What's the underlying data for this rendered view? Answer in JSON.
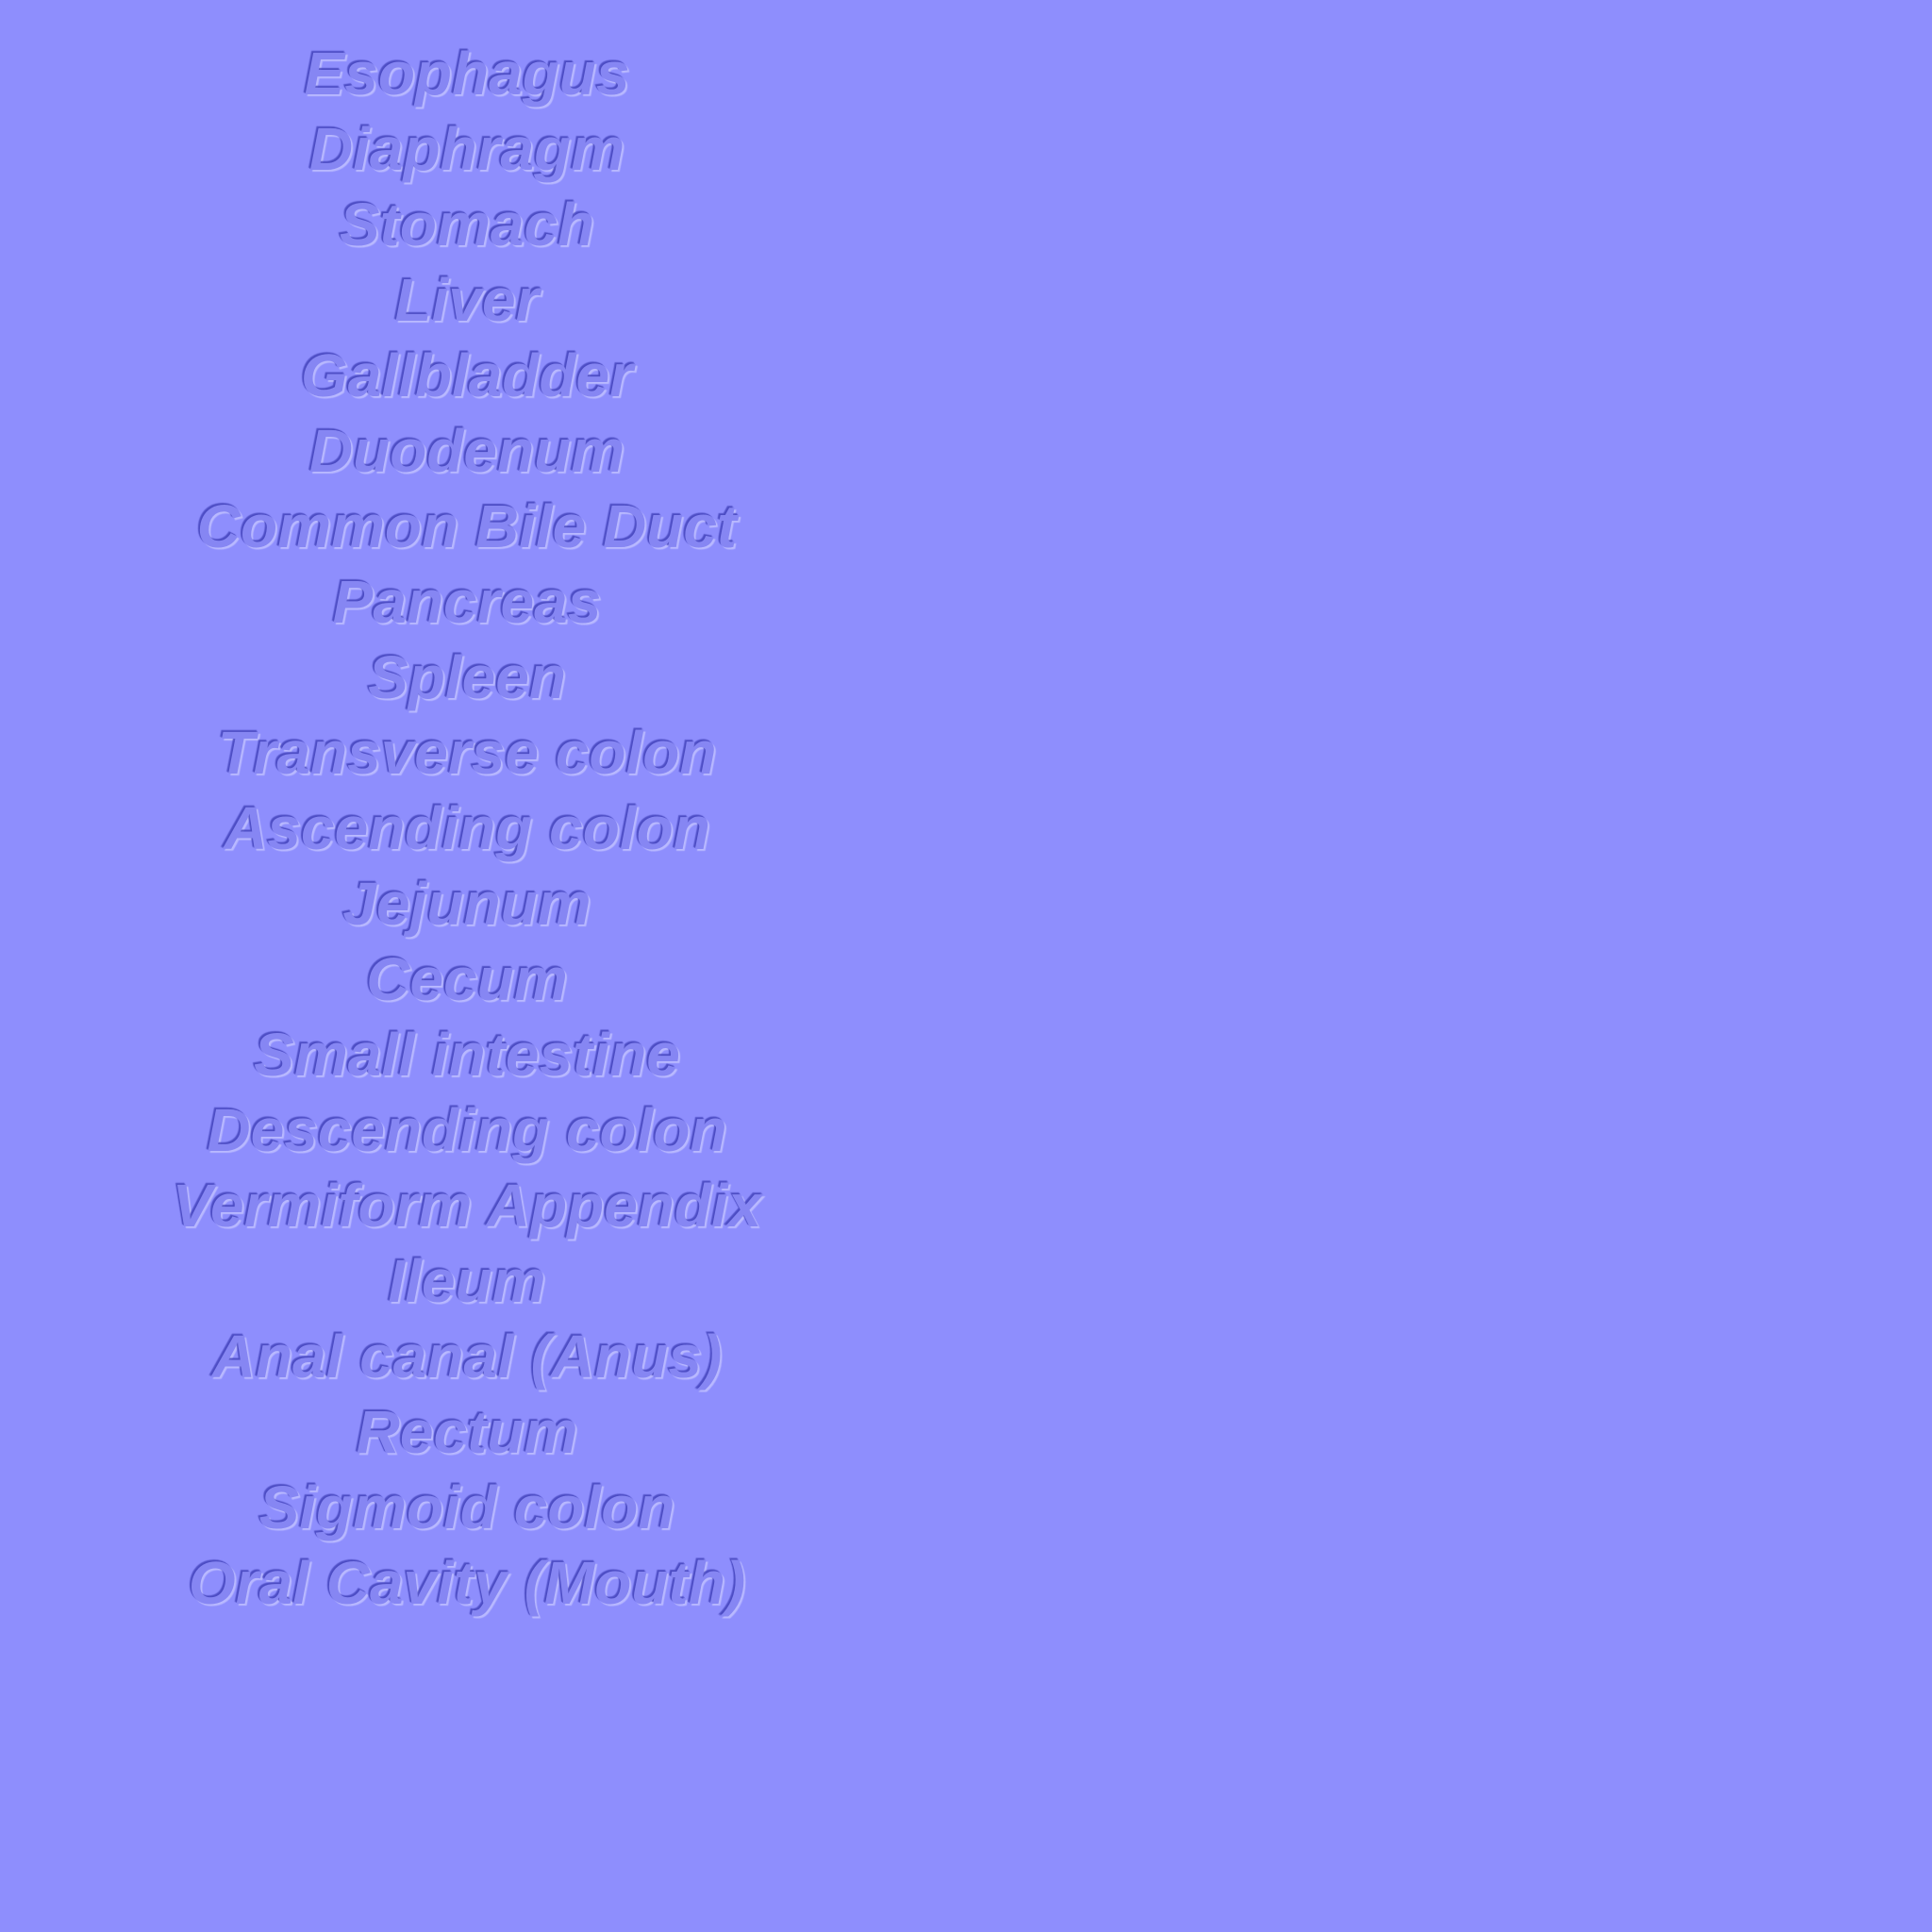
{
  "labels": [
    "Esophagus",
    "Diaphragm",
    "Stomach",
    "Liver",
    "Gallbladder",
    "Duodenum",
    "Common Bile Duct",
    "Pancreas",
    "Spleen",
    "Transverse colon",
    "Ascending colon",
    "Jejunum",
    "Cecum",
    "Small intestine",
    "Descending colon",
    "Vermiform Appendix",
    "Ileum",
    "Anal canal (Anus)",
    "Rectum",
    "Sigmoid colon",
    "Oral Cavity (Mouth)"
  ],
  "colors": {
    "background": "#8e8efd",
    "text": "#8686f3"
  }
}
